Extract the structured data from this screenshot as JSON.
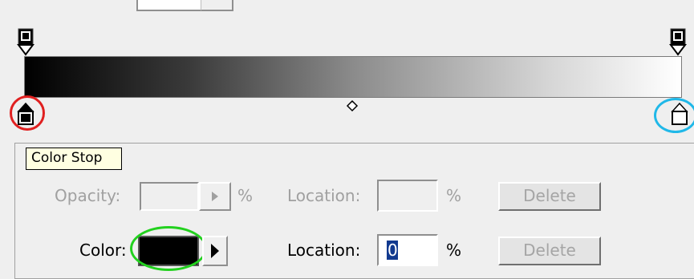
{
  "gradient_editor": {
    "stops": {
      "color_stop_start_color": "#000000",
      "color_stop_end_color": "#ffffff"
    },
    "highlights": {
      "start_stop_ring": "#e02020",
      "end_stop_ring": "#20b8e8",
      "color_swatch_ring": "#22d11e"
    }
  },
  "tooltip": {
    "text": "Color Stop"
  },
  "stops_panel": {
    "opacity_row": {
      "opacity_label": "Opacity:",
      "opacity_unit": "%",
      "location_label": "Location:",
      "location_unit": "%",
      "delete_label": "Delete"
    },
    "color_row": {
      "color_label": "Color:",
      "color_value": "#000000",
      "location_label": "Location:",
      "location_value": "0",
      "location_unit": "%",
      "delete_label": "Delete"
    }
  },
  "icons": {
    "opacity_stop": "opacity-stop-icon",
    "color_stop": "color-stop-icon",
    "midpoint": "midpoint-diamond-icon",
    "arrow": "triangle-right-icon"
  }
}
